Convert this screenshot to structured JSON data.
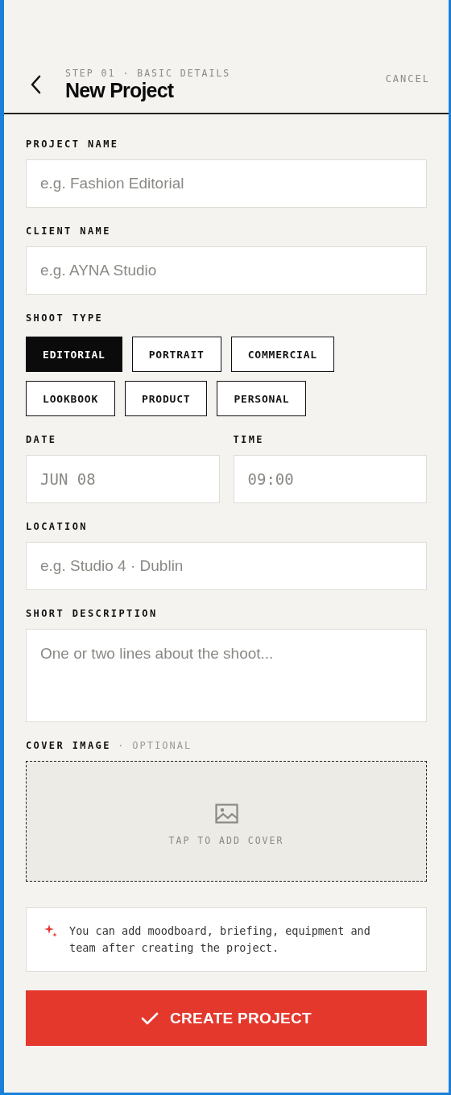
{
  "header": {
    "step": "STEP 01 · BASIC DETAILS",
    "title": "New Project",
    "cancel": "CANCEL"
  },
  "project_name": {
    "label": "PROJECT NAME",
    "placeholder": "e.g. Fashion Editorial"
  },
  "client_name": {
    "label": "CLIENT NAME",
    "placeholder": "e.g. AYNA Studio"
  },
  "shoot_type": {
    "label": "SHOOT TYPE",
    "options": [
      {
        "label": "EDITORIAL",
        "selected": true
      },
      {
        "label": "PORTRAIT",
        "selected": false
      },
      {
        "label": "COMMERCIAL",
        "selected": false
      },
      {
        "label": "LOOKBOOK",
        "selected": false
      },
      {
        "label": "PRODUCT",
        "selected": false
      },
      {
        "label": "PERSONAL",
        "selected": false
      }
    ]
  },
  "date": {
    "label": "DATE",
    "placeholder": "JUN 08"
  },
  "time": {
    "label": "TIME",
    "placeholder": "09:00"
  },
  "location": {
    "label": "LOCATION",
    "placeholder": "e.g. Studio 4 · Dublin"
  },
  "short_description": {
    "label": "SHORT DESCRIPTION",
    "placeholder": "One or two lines about the shoot..."
  },
  "cover_image": {
    "label": "COVER IMAGE",
    "hint": "· OPTIONAL",
    "prompt": "TAP TO ADD COVER"
  },
  "note": "You can add moodboard, briefing, equipment and team after creating the project.",
  "create_button": "CREATE PROJECT"
}
